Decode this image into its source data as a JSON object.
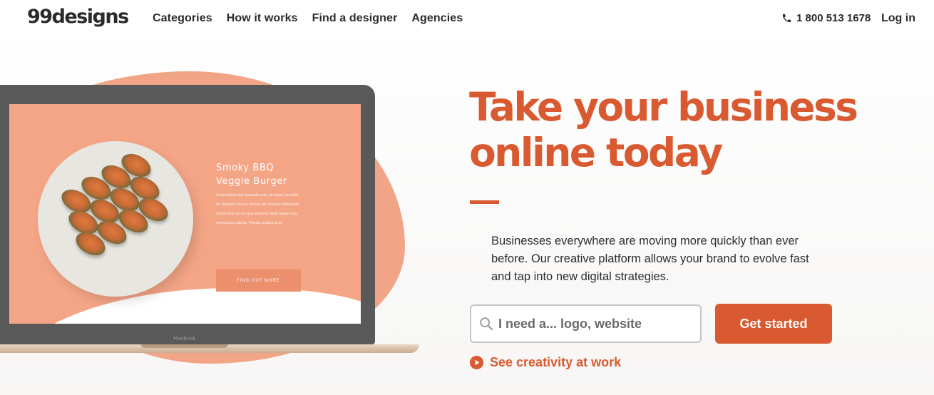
{
  "header": {
    "logo": "99designs",
    "nav": [
      "Categories",
      "How it works",
      "Find a designer",
      "Agencies"
    ],
    "phone": "1 800 513 1678",
    "login": "Log in"
  },
  "illustration": {
    "screen_title_1": "Smoky BBQ",
    "screen_title_2": "Veggie Burger",
    "screen_body": "Suspendisse sed venenatis ante, id ornare convallis mi. Aliquam rhoncus ultrices leo, rhoncus elementum. Sed pretium ac leo quis euismod. Nulla augue nunc, viverra quis odio ac, fringilla sodales urna.",
    "screen_button": "FIND OUT MORE",
    "laptop_label": "MacBook"
  },
  "hero": {
    "headline_line1": "Take your business",
    "headline_line2": "online today",
    "description": "Businesses everywhere are moving more quickly than ever before. Our creative platform allows your brand to evolve fast and tap into new digital strategies.",
    "search_placeholder": "I need a... logo, website",
    "cta_label": "Get started",
    "creativity_link": "See creativity at work"
  },
  "colors": {
    "brand": "#d95a30",
    "blob": "#f2a487"
  },
  "icons": [
    "phone-icon",
    "search-icon",
    "play-icon"
  ]
}
